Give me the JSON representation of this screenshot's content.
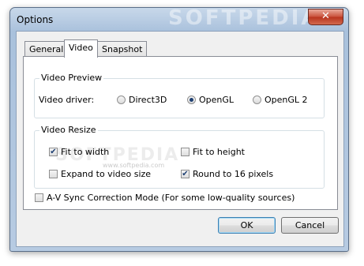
{
  "window": {
    "title": "Options",
    "close_label": "✕",
    "watermark": "SOFTPEDIA"
  },
  "tabs": [
    {
      "label": "General"
    },
    {
      "label": "Video",
      "active": true
    },
    {
      "label": "Snapshot"
    }
  ],
  "video_preview": {
    "title": "Video Preview",
    "driver_label": "Video driver:",
    "options": [
      {
        "label": "Direct3D",
        "selected": false
      },
      {
        "label": "OpenGL",
        "selected": true
      },
      {
        "label": "OpenGL 2",
        "selected": false
      }
    ],
    "watermark": "SOFTPEDIA",
    "watermark_url": "www.softpedia.com"
  },
  "video_resize": {
    "title": "Video Resize",
    "options": [
      {
        "label": "Fit to width",
        "checked": true
      },
      {
        "label": "Fit to height",
        "checked": false
      },
      {
        "label": "Expand to video size",
        "checked": false
      },
      {
        "label": "Round to 16 pixels",
        "checked": true
      }
    ]
  },
  "av_sync": {
    "label": "A-V Sync Correction Mode (For some low-quality sources)",
    "checked": false
  },
  "buttons": {
    "ok": "OK",
    "cancel": "Cancel"
  },
  "check_mark": "✔"
}
